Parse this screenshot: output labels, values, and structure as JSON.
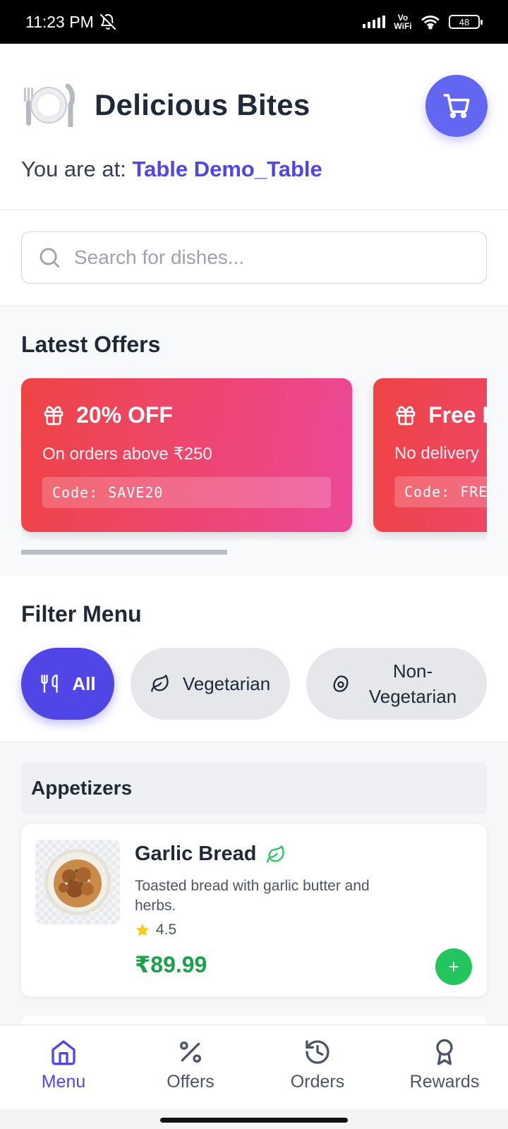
{
  "status_bar": {
    "time": "11:23 PM",
    "network_label": "Vo WiFi",
    "battery": "48"
  },
  "header": {
    "brand_name": "Delicious Bites",
    "brand_icon": "plate-cutlery-icon",
    "cart_icon": "cart-icon",
    "location_prefix": "You are at:",
    "table_name": "Table Demo_Table"
  },
  "search": {
    "placeholder": "Search for dishes..."
  },
  "offers": {
    "title": "Latest Offers",
    "items": [
      {
        "title": "20% OFF",
        "description": "On orders above ₹250",
        "code_label": "Code:",
        "code": "SAVE20",
        "icon": "gift-icon"
      },
      {
        "title": "Free D",
        "description": "No delivery",
        "code_label": "Code:",
        "code": "FRE",
        "icon": "gift-icon"
      }
    ]
  },
  "filter": {
    "title": "Filter Menu",
    "options": [
      {
        "label": "All",
        "icon": "utensils-icon",
        "active": true
      },
      {
        "label": "Vegetarian",
        "icon": "leaf-icon",
        "active": false
      },
      {
        "label": "Non-Vegetarian",
        "icon": "egg-icon",
        "active": false
      }
    ]
  },
  "menu": {
    "category": "Appetizers",
    "items": [
      {
        "name": "Garlic Bread",
        "veg": true,
        "description": "Toasted bread with garlic butter and herbs.",
        "rating": "4.5",
        "price": "₹89.99",
        "add_label": "+"
      }
    ]
  },
  "bottom_nav": {
    "items": [
      {
        "label": "Menu",
        "icon": "home-icon",
        "active": true
      },
      {
        "label": "Offers",
        "icon": "percent-icon",
        "active": false
      },
      {
        "label": "Orders",
        "icon": "history-icon",
        "active": false
      },
      {
        "label": "Rewards",
        "icon": "award-icon",
        "active": false
      }
    ]
  },
  "colors": {
    "primary": "#4f46e5",
    "cart": "#6366f1",
    "price": "#16a34a",
    "add_button": "#22c55e",
    "offer_gradient_start": "#ef4444",
    "offer_gradient_end": "#ec4899"
  }
}
